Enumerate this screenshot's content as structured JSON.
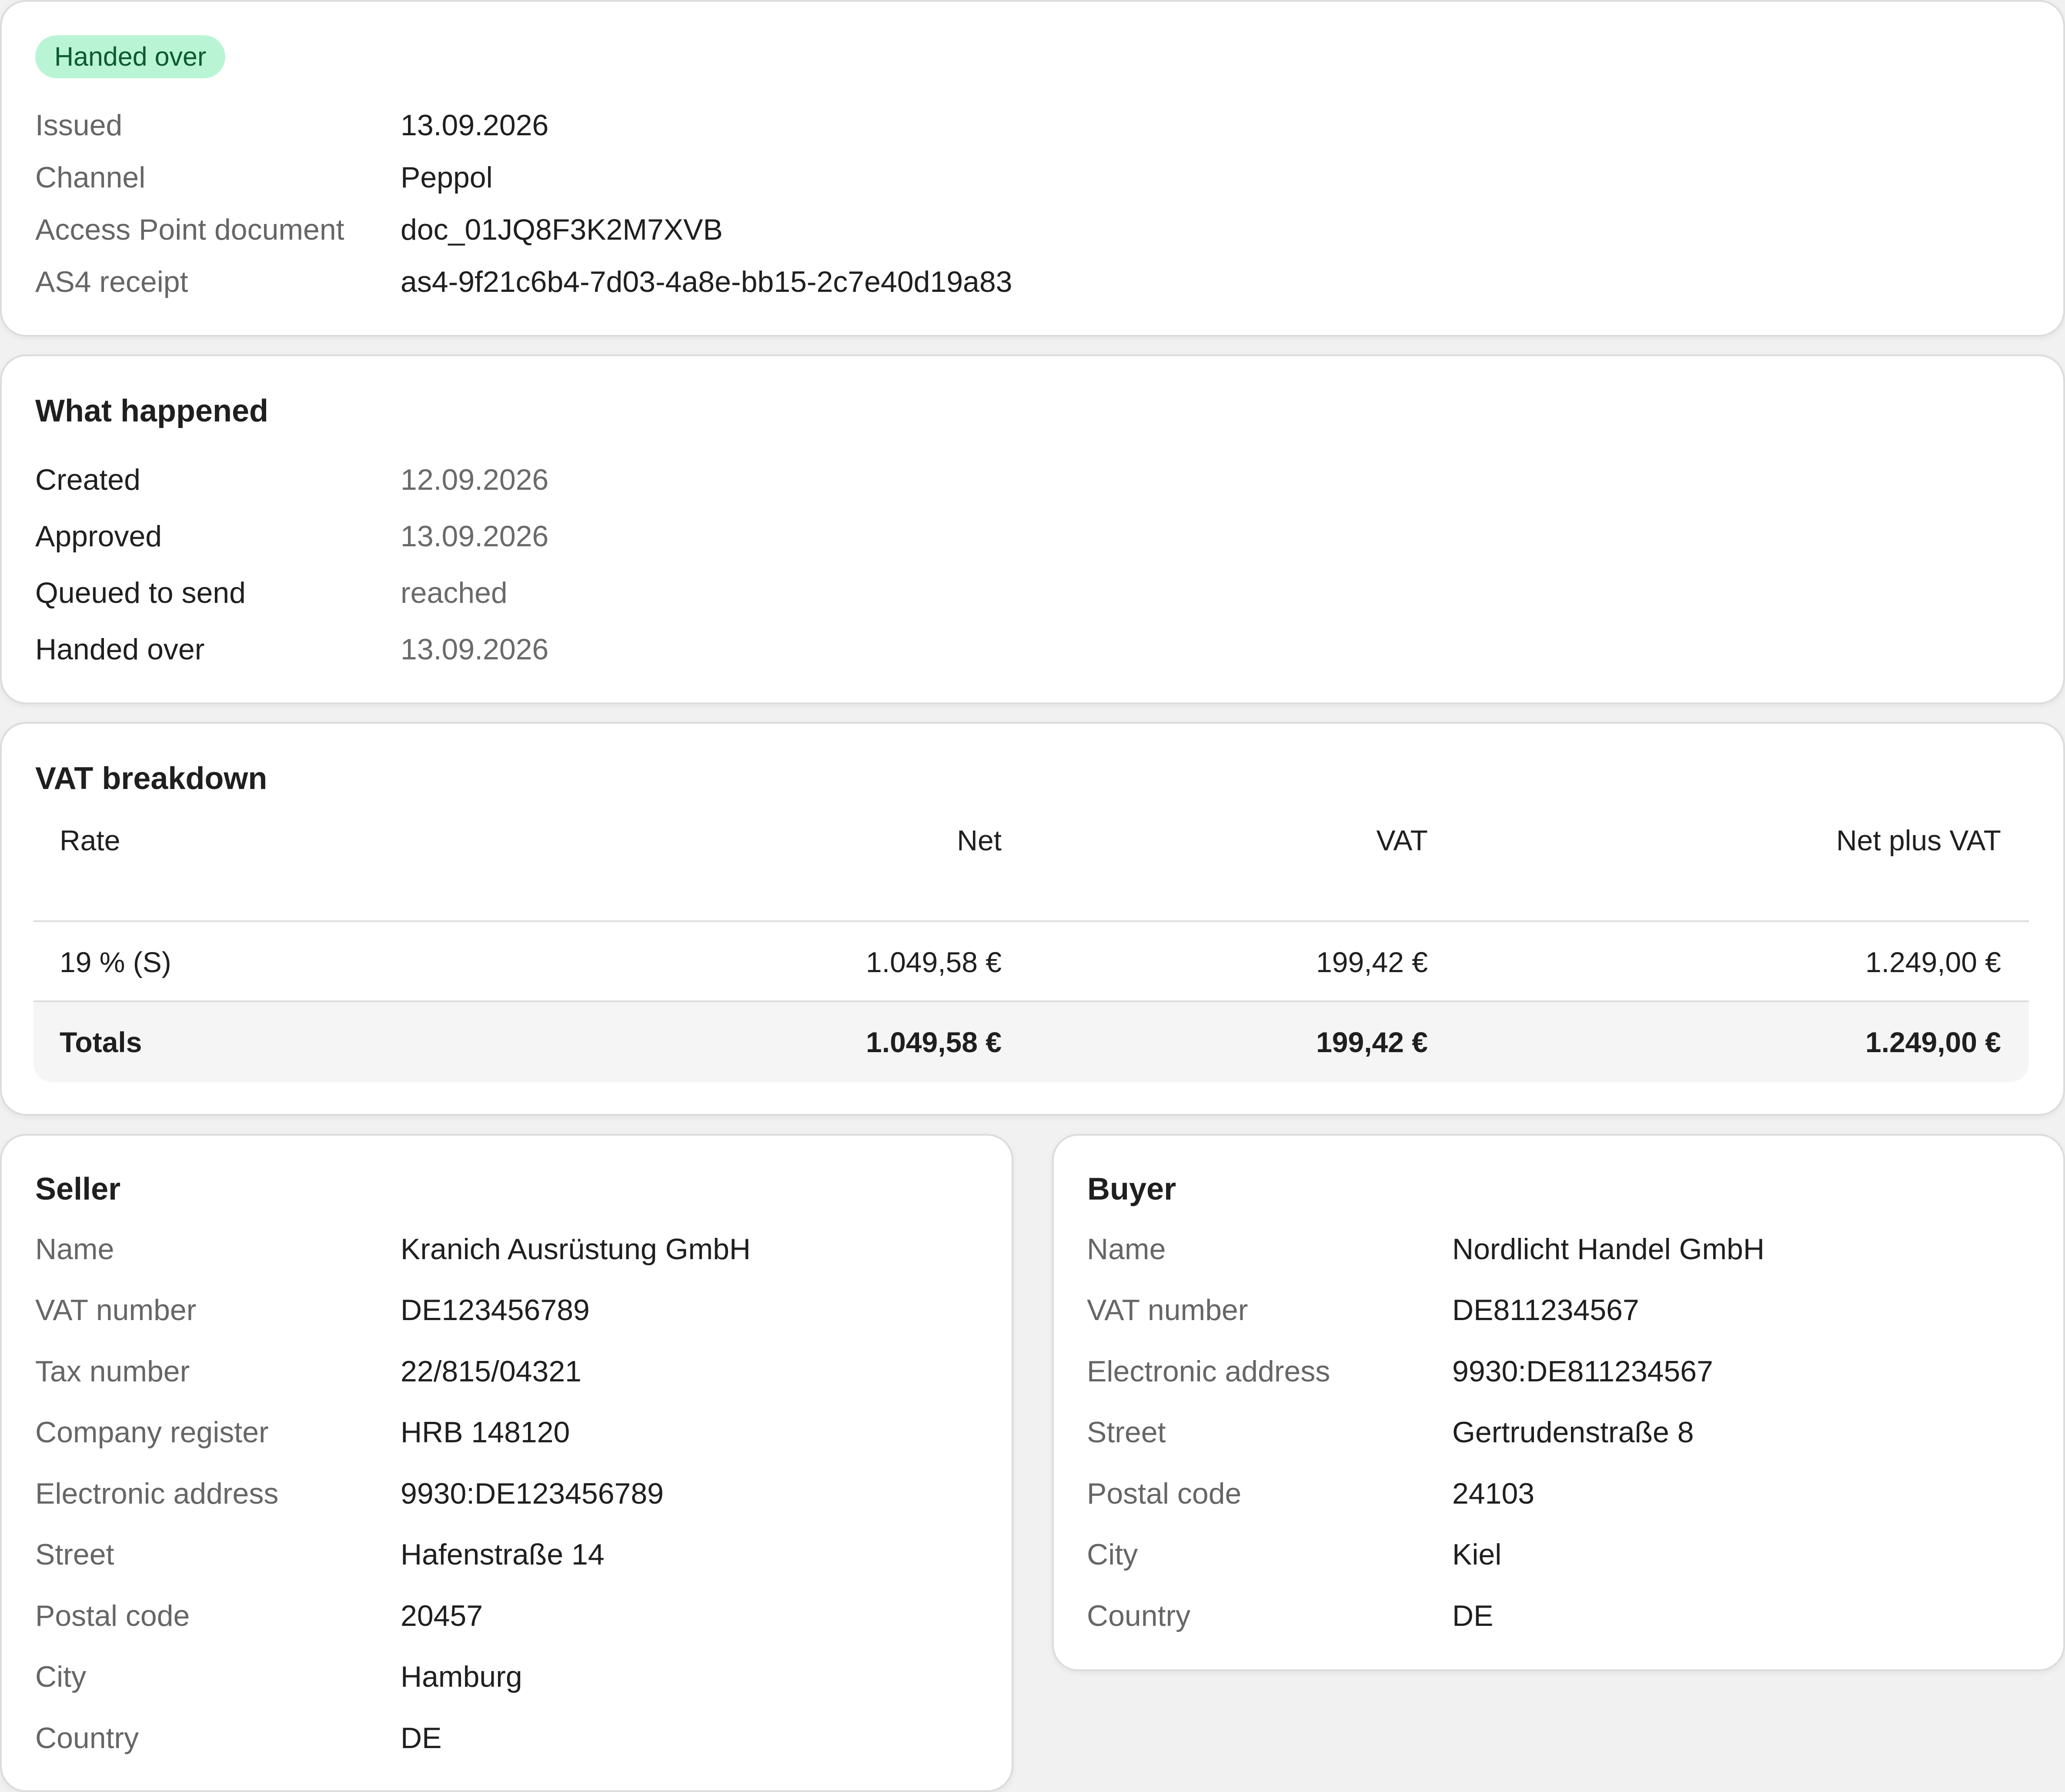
{
  "status": {
    "badge": "Handed over",
    "fields": [
      {
        "label": "Issued",
        "value": "13.09.2026"
      },
      {
        "label": "Channel",
        "value": "Peppol"
      },
      {
        "label": "Access Point document",
        "value": "doc_01JQ8F3K2M7XVB"
      },
      {
        "label": "AS4 receipt",
        "value": "as4-9f21c6b4-7d03-4a8e-bb15-2c7e40d19a83"
      }
    ]
  },
  "history": {
    "title": "What happened",
    "events": [
      {
        "label": "Created",
        "value": "12.09.2026"
      },
      {
        "label": "Approved",
        "value": "13.09.2026"
      },
      {
        "label": "Queued to send",
        "value": "reached"
      },
      {
        "label": "Handed over",
        "value": "13.09.2026"
      }
    ]
  },
  "vat": {
    "title": "VAT breakdown",
    "headers": {
      "rate": "Rate",
      "net": "Net",
      "vat": "VAT",
      "gross": "Net plus VAT"
    },
    "rows": [
      {
        "rate": "19 % (S)",
        "net": "1.049,58 €",
        "vat": "199,42 €",
        "gross": "1.249,00 €"
      }
    ],
    "totals": {
      "label": "Totals",
      "net": "1.049,58 €",
      "vat": "199,42 €",
      "gross": "1.249,00 €"
    }
  },
  "seller": {
    "title": "Seller",
    "fields": [
      {
        "label": "Name",
        "value": "Kranich Ausrüstung GmbH"
      },
      {
        "label": "VAT number",
        "value": "DE123456789"
      },
      {
        "label": "Tax number",
        "value": "22/815/04321"
      },
      {
        "label": "Company register",
        "value": "HRB 148120"
      },
      {
        "label": "Electronic address",
        "value": "9930:DE123456789"
      },
      {
        "label": "Street",
        "value": "Hafenstraße 14"
      },
      {
        "label": "Postal code",
        "value": "20457"
      },
      {
        "label": "City",
        "value": "Hamburg"
      },
      {
        "label": "Country",
        "value": "DE"
      }
    ]
  },
  "buyer": {
    "title": "Buyer",
    "fields": [
      {
        "label": "Name",
        "value": "Nordlicht Handel GmbH"
      },
      {
        "label": "VAT number",
        "value": "DE811234567"
      },
      {
        "label": "Electronic address",
        "value": "9930:DE811234567"
      },
      {
        "label": "Street",
        "value": "Gertrudenstraße 8"
      },
      {
        "label": "Postal code",
        "value": "24103"
      },
      {
        "label": "City",
        "value": "Kiel"
      },
      {
        "label": "Country",
        "value": "DE"
      }
    ]
  }
}
